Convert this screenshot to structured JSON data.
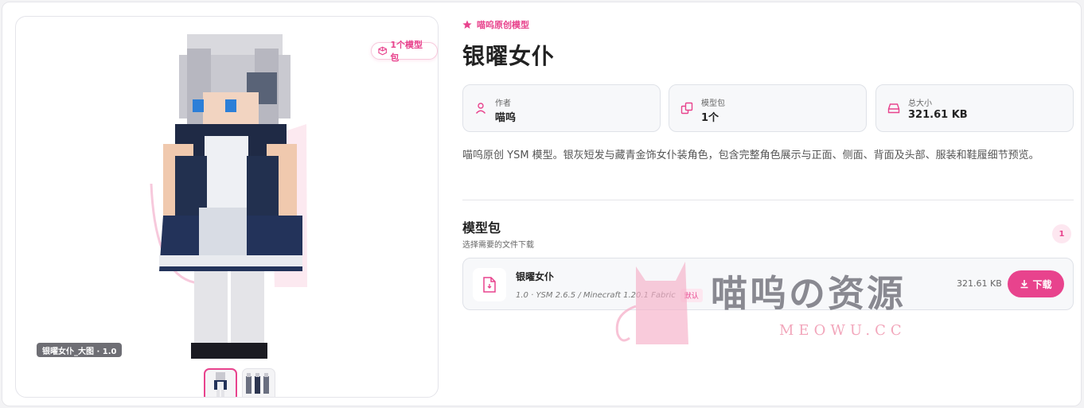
{
  "preview": {
    "pack_badge": "1个模型包",
    "image_label": "银曜女仆_大图 · 1.0",
    "thumbnails": [
      {
        "name": "thumb-front",
        "active": true
      },
      {
        "name": "thumb-views",
        "active": false
      }
    ]
  },
  "header": {
    "tag": "喵呜原创模型",
    "title": "银曜女仆"
  },
  "stats": [
    {
      "label": "作者",
      "value": "喵呜",
      "icon": "user-icon"
    },
    {
      "label": "模型包",
      "value": "1个",
      "icon": "package-icon"
    },
    {
      "label": "总大小",
      "value": "321.61 KB",
      "icon": "drive-icon"
    }
  ],
  "description": "喵呜原创 YSM 模型。银灰短发与藏青金饰女仆装角色，包含完整角色展示与正面、侧面、背面及头部、服装和鞋履细节预览。",
  "packs": {
    "title": "模型包",
    "subtitle": "选择需要的文件下载",
    "count": "1",
    "files": [
      {
        "name": "银曜女仆",
        "meta": "1.0 · YSM 2.6.5 / Minecraft 1.20.1 Fabric",
        "badge": "默认",
        "size": "321.61 KB",
        "download_label": "下载"
      }
    ]
  },
  "watermark": {
    "text": "喵呜の资源",
    "sub": "MEOWU.CC"
  },
  "colors": {
    "accent": "#e8438d",
    "accent_soft": "#fde7f0",
    "card_bg": "#f7f8fa"
  }
}
